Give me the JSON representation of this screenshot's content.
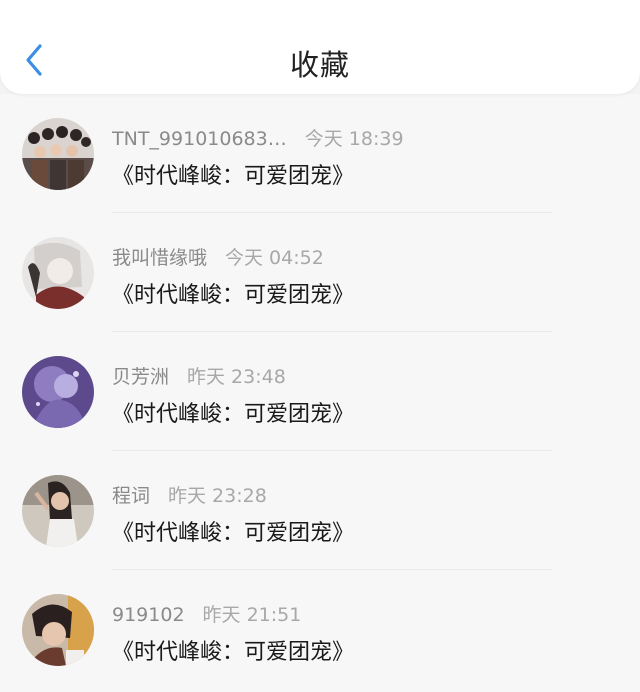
{
  "header": {
    "title": "收藏",
    "back_icon": "chevron-left-icon",
    "accent_color": "#3a8ee6"
  },
  "items": [
    {
      "username": "TNT_991010683…",
      "time": "今天 18:39",
      "title": "《时代峰峻：可爱团宠》"
    },
    {
      "username": "我叫惜缘哦",
      "time": "今天 04:52",
      "title": "《时代峰峻：可爱团宠》"
    },
    {
      "username": "贝芳洲",
      "time": "昨天 23:48",
      "title": "《时代峰峻：可爱团宠》"
    },
    {
      "username": "程词",
      "time": "昨天 23:28",
      "title": "《时代峰峻：可爱团宠》"
    },
    {
      "username": "919102",
      "time": "昨天 21:51",
      "title": "《时代峰峻：可爱团宠》"
    }
  ]
}
